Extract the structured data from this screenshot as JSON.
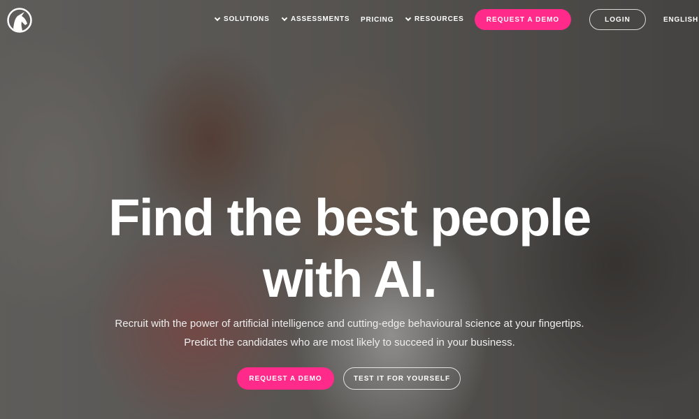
{
  "nav": {
    "logo": "unicorn-logo",
    "items": [
      {
        "label": "SOLUTIONS",
        "dropdown": true
      },
      {
        "label": "ASSESSMENTS",
        "dropdown": true
      },
      {
        "label": "PRICING",
        "dropdown": false
      },
      {
        "label": "RESOURCES",
        "dropdown": true
      }
    ],
    "request_demo": "REQUEST A DEMO",
    "login": "LOGIN",
    "language": "ENGLISH"
  },
  "hero": {
    "title": "Find the best people with AI.",
    "subtitle_1": "Recruit with the power of artificial intelligence and cutting-edge behavioural science at your fingertips.",
    "subtitle_2": "Predict the candidates who are most likely to succeed in your business.",
    "request_demo": "REQUEST A DEMO",
    "test_it": "TEST IT FOR YOURSELF"
  },
  "colors": {
    "accent": "#ff2a8a"
  }
}
